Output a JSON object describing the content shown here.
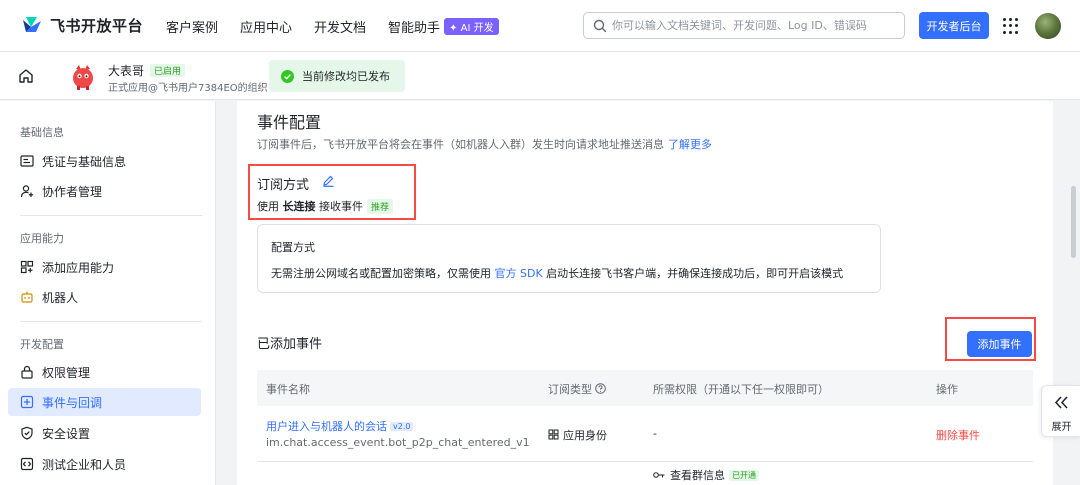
{
  "brand": {
    "name": "飞书开放平台",
    "colors": {
      "primary": "#3370ff",
      "danger": "#f54a45",
      "success": "#2ea121"
    }
  },
  "nav": {
    "items": [
      "客户案例",
      "应用中心",
      "开发文档",
      "智能助手"
    ],
    "ai_badge": "✦ AI 开发",
    "search_placeholder": "你可以输入文档关键词、开发问题、Log ID、错误码",
    "dev_console": "开发者后台"
  },
  "app": {
    "name": "大表哥",
    "status": "已启用",
    "subtitle": "正式应用@飞书用户7384EO的组织",
    "toast": "当前修改均已发布"
  },
  "sidebar": {
    "sections": [
      {
        "title": "基础信息",
        "items": [
          {
            "label": "凭证与基础信息",
            "icon": "id-card-icon"
          },
          {
            "label": "协作者管理",
            "icon": "user-add-icon"
          }
        ]
      },
      {
        "title": "应用能力",
        "items": [
          {
            "label": "添加应用能力",
            "icon": "grid-add-icon"
          },
          {
            "label": "机器人",
            "icon": "robot-icon"
          }
        ]
      },
      {
        "title": "开发配置",
        "items": [
          {
            "label": "权限管理",
            "icon": "lock-icon"
          },
          {
            "label": "事件与回调",
            "icon": "event-icon",
            "active": true
          },
          {
            "label": "安全设置",
            "icon": "shield-icon"
          },
          {
            "label": "测试企业和人员",
            "icon": "code-icon"
          }
        ]
      }
    ]
  },
  "main": {
    "title": "事件配置",
    "desc": "订阅事件后，飞书开放平台将会在事件（如机器人入群）发生时向请求地址推送消息",
    "learn_more": "了解更多",
    "sub_mode": {
      "title": "订阅方式",
      "prefix": "使用",
      "mode": "长连接",
      "suffix": "接收事件",
      "badge": "推荐"
    },
    "config": {
      "title": "配置方式",
      "desc_prefix": "无需注册公网域名或配置加密策略，仅需使用",
      "sdk": "官方 SDK",
      "desc_suffix": "启动长连接飞书客户端，并确保连接成功后，即可开启该模式"
    },
    "events_title": "已添加事件",
    "add_event": "添加事件",
    "table": {
      "headers": [
        "事件名称",
        "订阅类型",
        "所需权限（开通以下任一权限即可）",
        "操作"
      ],
      "rows": [
        {
          "name": "用户进入与机器人的会话",
          "version": "v2.0",
          "code": "im.chat.access_event.bot_p2p_chat_entered_v1",
          "type": "应用身份",
          "permission": "-",
          "action": "删除事件"
        }
      ],
      "partial_row": {
        "permission": "查看群信息",
        "badge": "已开通"
      }
    }
  },
  "expand": {
    "label": "展开"
  }
}
